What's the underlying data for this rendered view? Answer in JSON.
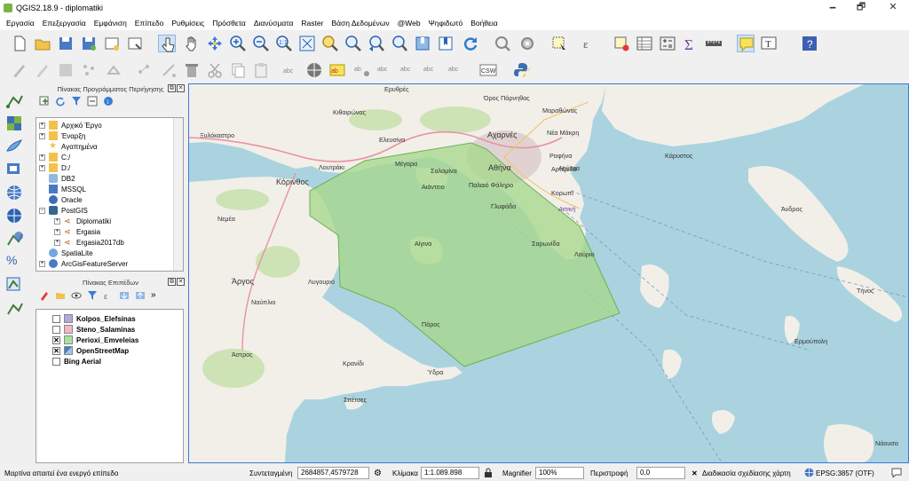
{
  "window": {
    "title": "QGIS2.18.9 - diplomatiki",
    "minimize": "🗕",
    "maximize": "🗗",
    "close": "✕"
  },
  "menu": [
    "Εργασία",
    "Επεξεργασία",
    "Εμφάνιση",
    "Επίπεδο",
    "Ρυθμίσεις",
    "Πρόσθετα",
    "Διανύσματα",
    "Raster",
    "Βάση Δεδομένων",
    "@Web",
    "Ψηφιδωτό",
    "Βοήθεια"
  ],
  "browser_panel": {
    "title": "Πίνακας Προγράμματος Περιήγησης",
    "items": [
      "Αρχικό Έργο",
      "Έναρξη",
      "Αγαπημένα",
      "C:/",
      "D:/",
      "DB2",
      "MSSQL",
      "Oracle",
      "PostGIS",
      "Diplomatiki",
      "Ergasia",
      "Ergasia2017db",
      "SpatiaLite",
      "ArcGisFeatureServer"
    ]
  },
  "layers_panel": {
    "title": "Πίνακας Επιπέδων",
    "layers": [
      {
        "name": "Kolpos_Elefsinas",
        "checked": false,
        "color": "#b7a6e0"
      },
      {
        "name": "Steno_Salaminas",
        "checked": false,
        "color": "#f5b7c3"
      },
      {
        "name": "Perioxi_Emveleias",
        "checked": true,
        "color": "#a8e0a0"
      },
      {
        "name": "OpenStreetMap",
        "checked": true,
        "color": "#4a7cc2"
      },
      {
        "name": "Bing Aerial",
        "checked": false,
        "color": ""
      }
    ]
  },
  "map_labels": {
    "erythres": "Ερυθρές",
    "kitheronas": "Κιθαιρώνας",
    "marathonas": "Μαραθώνας",
    "parnitha": "Όρος Πάρνηθας",
    "acharnes": "Αχαρνές",
    "nea_makri": "Νέα Μάκρη",
    "loutsa": "Λούτσα",
    "karystos": "Κάρυστος",
    "xylokastro": "Ξυλόκαστρο",
    "loutraki": "Λουτράκι",
    "megara": "Μέγαρα",
    "eleusis": "Ελευσίνα",
    "athina": "Αθήνα",
    "rafina": "Ραφήνα",
    "artemida": "Αρτέμιδα",
    "korinthos": "Κόρινθος",
    "salamina": "Σαλαμίνα",
    "aiantio": "Αιάντειο",
    "palaio_faliro": "Παλαιό Φάληρο",
    "koropi": "Κορωπί",
    "attiki": "Αττική",
    "nemea": "Νεμέα",
    "glyfada": "Γλυφάδα",
    "andros": "Άνδρος",
    "aigina": "Αίγινα",
    "saronida": "Σαρωνίδα",
    "lavrio": "Λαύριο",
    "argos": "Άργος",
    "ligourio": "Λυγουριό",
    "tinos": "Τήνος",
    "nafplio": "Ναύπλιο",
    "poros": "Πόρος",
    "ermoupoli": "Ερμούπολη",
    "astros": "Άστρος",
    "kranidi": "Κρανίδι",
    "ydra": "Ύδρα",
    "spetses": "Σπέτσες",
    "naousa": "Νάουσα"
  },
  "status": {
    "message": "Μαρτίνα απαιτεί ένα ενεργό επίπεδο",
    "coord_label": "Συντεταγμένη",
    "coord_value": "2684857,4579728",
    "scale_label": "Κλίμακα",
    "scale_value": "1:1.089.898",
    "magnifier_label": "Magnifier",
    "magnifier_value": "100%",
    "rotation_label": "Περιστροφή",
    "rotation_value": "0,0",
    "render_label": "Διαδικασία σχεδίασης χάρτη",
    "crs": "EPSG:3857 (OTF)"
  },
  "colors": {
    "sea": "#aad3df",
    "land": "#f2efe9",
    "polygon_fill": "#a7d98c",
    "polygon_stroke": "#6fae57",
    "accent": "#3b7bd6"
  },
  "tool_icons": [
    "new-project-icon",
    "open-project-icon",
    "save-project-icon",
    "save-as-icon",
    "new-print-composer-icon",
    "composer-manager-icon",
    "touch-zoom-icon",
    "pan-icon",
    "pan-to-selection-icon",
    "zoom-in-icon",
    "zoom-out-icon",
    "zoom-actual-icon",
    "zoom-full-icon",
    "zoom-to-selection-icon",
    "zoom-to-layer-icon",
    "zoom-last-icon",
    "zoom-next-icon",
    "new-bookmark-icon",
    "show-bookmarks-icon",
    "refresh-icon",
    "identify-icon",
    "run-action-icon",
    "select-features-icon",
    "select-by-expression-icon",
    "deselect-icon",
    "attribute-table-icon",
    "field-calculator-icon",
    "statistics-icon",
    "measure-icon",
    "map-tips-icon",
    "text-annotation-icon",
    "help-icon"
  ]
}
